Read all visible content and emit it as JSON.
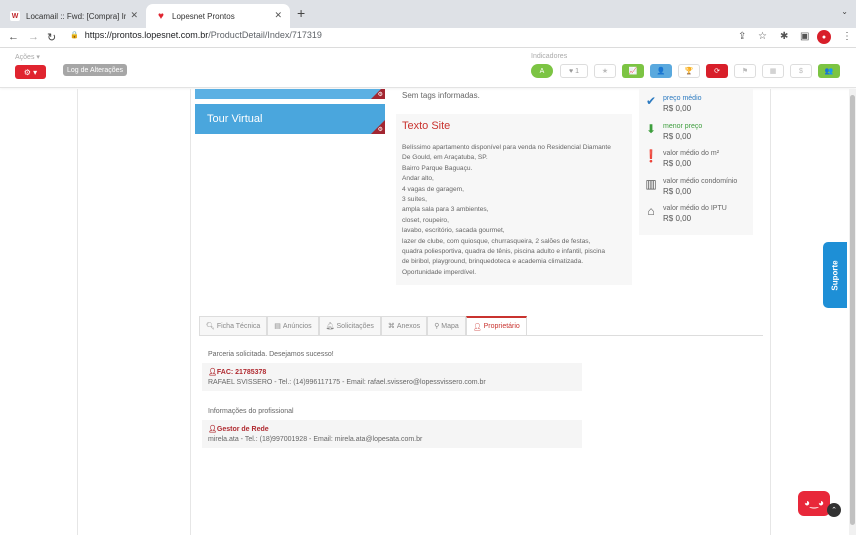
{
  "browser": {
    "tabs": [
      {
        "label": "Locamail :: Fwd: [Compra] Inte",
        "icon": "W"
      },
      {
        "label": "Lopesnet Prontos",
        "icon": "heart"
      }
    ],
    "url_host": "https://prontos.lopesnet.com.br",
    "url_path": "/ProductDetail/Index/717319"
  },
  "app_header": {
    "acoes_label": "Ações ▾",
    "log_label": "Log de Alterações",
    "indicadores_label": "Indicadores",
    "indicator_a": "A",
    "like_count": "1"
  },
  "left_panel": {
    "tour_label": "Tour Virtual"
  },
  "main": {
    "tags_text": "Sem tags informadas.",
    "texto_site_title": "Texto Site",
    "texto_site_lines": [
      "Belíssimo apartamento disponível para venda no Residencial Diamante",
      "De Gould, em Araçatuba, SP.",
      "Bairro Parque Baguaçu.",
      "Andar alto,",
      "4 vagas de garagem,",
      "3 suítes,",
      "ampla sala para 3 ambientes,",
      "closet, roupeiro,",
      "lavabo, escritório, sacada gourmet,",
      "lazer de clube, com quiosque, churrasqueira, 2 salões de festas,",
      "quadra poliesportiva, quadra de tênis, piscina adulto e infantil, piscina",
      "de biribol, playground, brinquedoteca e academia climatizada.",
      "Oportunidade imperdível."
    ]
  },
  "side_stats": [
    {
      "label": "preço médio",
      "value": "R$ 0,00",
      "icon": "check-icon",
      "color": "blue"
    },
    {
      "label": "menor preço",
      "value": "R$ 0,00",
      "icon": "arrow-down-icon",
      "color": "green"
    },
    {
      "label": "valor médio do m²",
      "value": "R$ 0,00",
      "icon": "exclamation-icon",
      "color": "gray"
    },
    {
      "label": "valor médio condomínio",
      "value": "R$ 0,00",
      "icon": "building-icon",
      "color": "gray"
    },
    {
      "label": "valor médio do IPTU",
      "value": "R$ 0,00",
      "icon": "home-icon",
      "color": "gray"
    }
  ],
  "tabs": [
    {
      "label": "Ficha Técnica"
    },
    {
      "label": "Anúncios"
    },
    {
      "label": "Solicitações"
    },
    {
      "label": "Anexos"
    },
    {
      "label": "Mapa"
    },
    {
      "label": "Proprietário"
    }
  ],
  "owner": {
    "status_text": "Parceria solicitada. Desejamos sucesso!",
    "fac_title": "FAC: 21785378",
    "fac_line": "RAFAEL SVISSERO - Tel.: (14)996117175 - Email: rafael.svissero@lopessvissero.com.br",
    "prof_label": "Informações do profissional",
    "gestor_title": "Gestor de Rede",
    "gestor_line": "mirela.ata - Tel.: (18)997001928 - Email: mirela.ata@lopesata.com.br"
  },
  "support_label": "Suporte",
  "colors": {
    "accent_red": "#e0242f",
    "panel_blue": "#4aa6dd",
    "ind_green": "#7cc443",
    "ind_blue": "#5aa9de",
    "support_blue": "#1e8fd6"
  }
}
